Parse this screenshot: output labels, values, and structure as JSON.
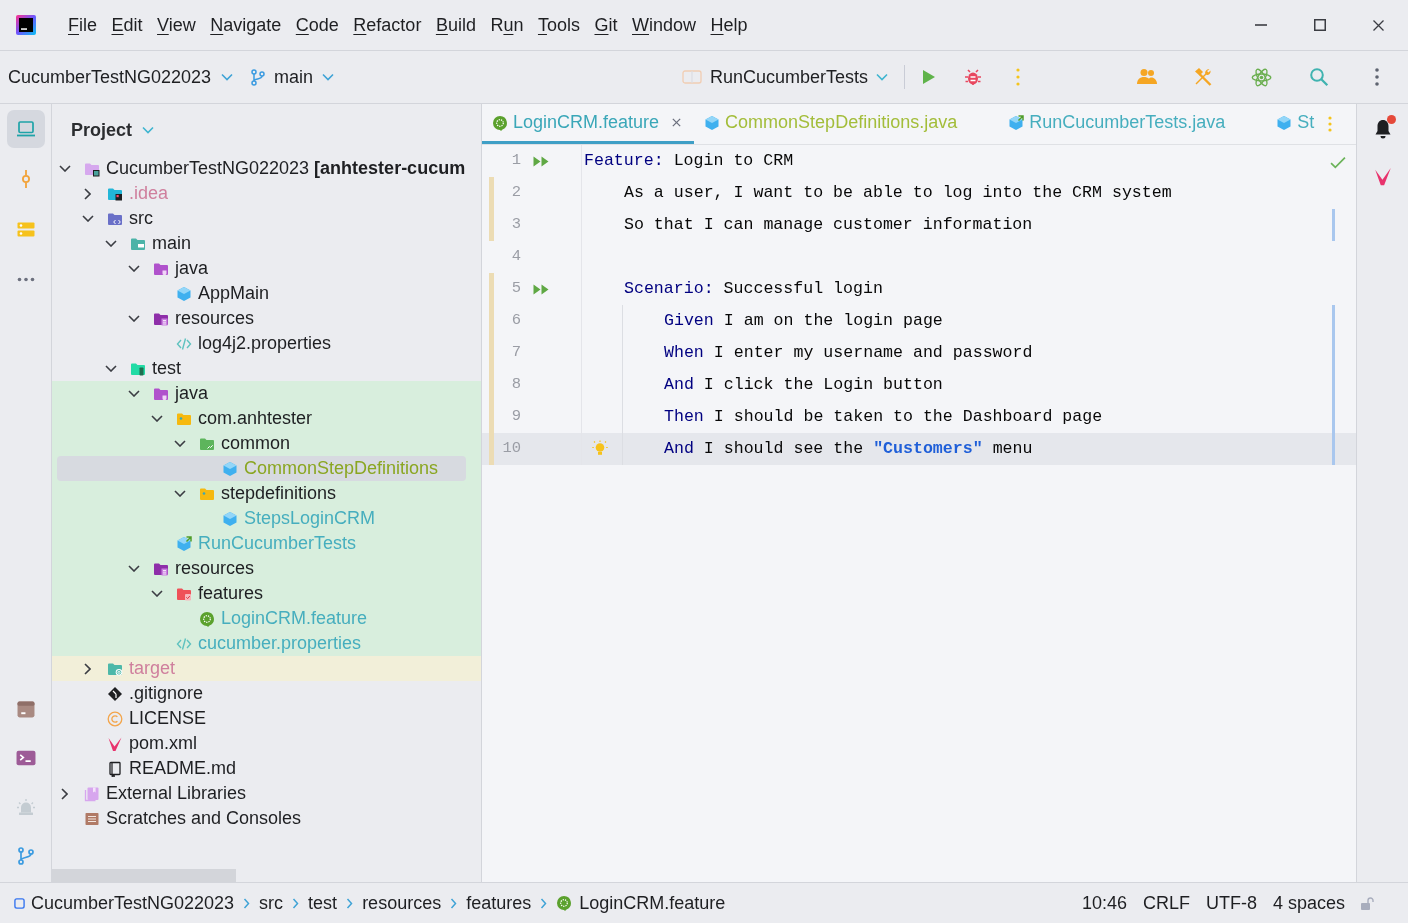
{
  "window": {
    "menu": [
      {
        "mnemonic": "F",
        "rest": "ile"
      },
      {
        "mnemonic": "E",
        "rest": "dit"
      },
      {
        "mnemonic": "V",
        "rest": "iew"
      },
      {
        "mnemonic": "N",
        "rest": "avigate"
      },
      {
        "mnemonic": "C",
        "rest": "ode"
      },
      {
        "mnemonic": "R",
        "rest": "efactor"
      },
      {
        "mnemonic": "B",
        "rest": "uild"
      },
      {
        "lead": "R",
        "mnemonic": "u",
        "rest": "n"
      },
      {
        "mnemonic": "T",
        "rest": "ools"
      },
      {
        "mnemonic": "G",
        "rest": "it"
      },
      {
        "mnemonic": "W",
        "rest": "indow"
      },
      {
        "mnemonic": "H",
        "rest": "elp"
      }
    ]
  },
  "toolbar": {
    "project": "CucumberTestNG022023",
    "branch": "main",
    "run_config": "RunCucumberTests"
  },
  "tool_strip": {
    "top": [
      {
        "kind": "project",
        "selected": true
      },
      {
        "kind": "commit",
        "selected": false
      },
      {
        "kind": "structure",
        "selected": false
      },
      {
        "kind": "more",
        "selected": false
      }
    ],
    "bottom": [
      {
        "kind": "services",
        "selected": false
      },
      {
        "kind": "terminal",
        "selected": false
      },
      {
        "kind": "problems",
        "selected": false
      },
      {
        "kind": "git",
        "selected": false
      }
    ]
  },
  "project_panel": {
    "title": "Project",
    "tree": [
      {
        "kind": "module",
        "label": "CucumberTestNG022023 **[anhtester-cucum**",
        "expanded": true,
        "selected": false,
        "children": [
          {
            "kind": "config",
            "label": ".idea",
            "color": "#cf7f9d",
            "expanded": false,
            "selected": false
          },
          {
            "kind": "src",
            "label": "src",
            "expanded": true,
            "selected": false,
            "children": [
              {
                "kind": "main",
                "label": "main",
                "expanded": true,
                "selected": false,
                "children": [
                  {
                    "kind": "javaroot",
                    "label": "java",
                    "expanded": true,
                    "selected": false,
                    "children": [
                      {
                        "kind": "class",
                        "label": "AppMain",
                        "selected": false
                      }
                    ]
                  },
                  {
                    "kind": "resroot",
                    "label": "resources",
                    "expanded": true,
                    "selected": false,
                    "children": [
                      {
                        "kind": "props",
                        "label": "log4j2.properties",
                        "selected": false
                      }
                    ]
                  }
                ]
              },
              {
                "kind": "testroot",
                "label": "test",
                "expanded": true,
                "selected": false,
                "children": [
                  {
                    "kind": "javaroot",
                    "label": "java",
                    "test_scope": true,
                    "expanded": true,
                    "selected": false,
                    "children": [
                      {
                        "kind": "package",
                        "label": "com.anhtester",
                        "test_scope": true,
                        "expanded": true,
                        "selected": false,
                        "children": [
                          {
                            "kind": "greenpackage",
                            "label": "common",
                            "test_scope": true,
                            "expanded": true,
                            "selected": false,
                            "children": [
                              {
                                "kind": "class",
                                "label": "CommonStepDefinitions",
                                "color": "#8aa621",
                                "test_scope": true,
                                "selected": true
                              }
                            ]
                          },
                          {
                            "kind": "package",
                            "label": "stepdefinitions",
                            "test_scope": true,
                            "expanded": true,
                            "selected": false,
                            "children": [
                              {
                                "kind": "class",
                                "label": "StepsLoginCRM",
                                "color": "#46aebe",
                                "test_scope": true,
                                "selected": false
                              }
                            ]
                          }
                        ]
                      },
                      {
                        "kind": "runner",
                        "label": "RunCucumberTests",
                        "color": "#46aebe",
                        "test_scope": true,
                        "selected": false
                      }
                    ]
                  },
                  {
                    "kind": "resroot",
                    "label": "resources",
                    "test_scope": true,
                    "expanded": true,
                    "selected": false,
                    "children": [
                      {
                        "kind": "featuredir",
                        "label": "features",
                        "test_scope": true,
                        "expanded": true,
                        "selected": false,
                        "children": [
                          {
                            "kind": "feature",
                            "label": "LoginCRM.feature",
                            "color": "#46aebe",
                            "test_scope": true,
                            "selected": false
                          }
                        ]
                      },
                      {
                        "kind": "props",
                        "label": "cucumber.properties",
                        "color": "#46aebe",
                        "test_scope": true,
                        "selected": false
                      }
                    ]
                  }
                ]
              }
            ]
          },
          {
            "kind": "excluded",
            "label": "target",
            "color": "#cf7f9d",
            "excluded": true,
            "expanded": false,
            "selected": false
          },
          {
            "kind": "git",
            "label": ".gitignore",
            "selected": false
          },
          {
            "kind": "license",
            "label": "LICENSE",
            "selected": false
          },
          {
            "kind": "maven",
            "label": "pom.xml",
            "selected": false
          },
          {
            "kind": "readme",
            "label": "README.md",
            "selected": false
          }
        ]
      },
      {
        "kind": "libraries",
        "label": "External Libraries",
        "expanded": false,
        "selected": false
      },
      {
        "kind": "scratches",
        "label": "Scratches and Consoles",
        "selected": false
      }
    ]
  },
  "editor": {
    "tabs": [
      {
        "kind": "feature",
        "label": "LoginCRM.feature",
        "color": "#3aa7b8",
        "selected": true
      },
      {
        "kind": "class",
        "label": "CommonStepDefinitions.java",
        "color": "#a3bd3a",
        "selected": false
      },
      {
        "kind": "runner",
        "label": "RunCucumberTests.java",
        "color": "#46aebe",
        "selected": false
      },
      {
        "kind": "class",
        "label": "St",
        "color": "#46aebe",
        "selected": false
      }
    ],
    "lines": [
      {
        "number": "1",
        "tokens": [
          {
            "kind": "keyword",
            "text": "Feature:"
          },
          {
            "kind": "text",
            "text": " Login to CRM"
          }
        ],
        "runnable": true,
        "changed": false,
        "marked": false,
        "current": false,
        "intention": false,
        "children": [
          {
            "number": "2",
            "tokens": [
              {
                "kind": "text",
                "text": "As a user, I want to be able to log into the CRM system"
              }
            ],
            "runnable": false,
            "changed": true,
            "marked": false,
            "current": false,
            "intention": false
          },
          {
            "number": "3",
            "tokens": [
              {
                "kind": "text",
                "text": "So that I can manage customer information"
              }
            ],
            "runnable": false,
            "changed": true,
            "marked": true,
            "current": false,
            "intention": false
          },
          {
            "number": "4",
            "runnable": false,
            "changed": false,
            "marked": false,
            "current": false,
            "intention": false
          },
          {
            "number": "5",
            "tokens": [
              {
                "kind": "keyword",
                "text": "Scenario:"
              },
              {
                "kind": "text",
                "text": " Successful login"
              }
            ],
            "runnable": true,
            "changed": true,
            "marked": false,
            "current": false,
            "intention": false,
            "children": [
              {
                "number": "6",
                "tokens": [
                  {
                    "kind": "keyword",
                    "text": "Given"
                  },
                  {
                    "kind": "text",
                    "text": " I am on the login page"
                  }
                ],
                "runnable": false,
                "changed": true,
                "marked": true,
                "current": false,
                "intention": false
              },
              {
                "number": "7",
                "tokens": [
                  {
                    "kind": "keyword",
                    "text": "When"
                  },
                  {
                    "kind": "text",
                    "text": " I enter my username and password"
                  }
                ],
                "runnable": false,
                "changed": true,
                "marked": true,
                "current": false,
                "intention": false
              },
              {
                "number": "8",
                "tokens": [
                  {
                    "kind": "keyword",
                    "text": "And"
                  },
                  {
                    "kind": "text",
                    "text": " I click the Login button"
                  }
                ],
                "runnable": false,
                "changed": true,
                "marked": true,
                "current": false,
                "intention": false
              },
              {
                "number": "9",
                "tokens": [
                  {
                    "kind": "keyword",
                    "text": "Then"
                  },
                  {
                    "kind": "text",
                    "text": " I should be taken to the Dashboard page"
                  }
                ],
                "runnable": false,
                "changed": true,
                "marked": true,
                "current": false,
                "intention": false
              },
              {
                "number": "10",
                "tokens": [
                  {
                    "kind": "keyword",
                    "text": "And"
                  },
                  {
                    "kind": "text",
                    "text": " I should see the "
                  },
                  {
                    "kind": "string",
                    "text": "\"Customers\""
                  },
                  {
                    "kind": "text",
                    "text": " menu"
                  }
                ],
                "runnable": false,
                "changed": true,
                "marked": true,
                "current": true,
                "intention": true
              }
            ]
          }
        ]
      }
    ]
  },
  "notifications": {
    "unread": true
  },
  "status_bar": {
    "breadcrumbs": [
      {
        "kind": "project",
        "label": "CucumberTestNG022023"
      },
      {
        "kind": "folder",
        "label": "src"
      },
      {
        "kind": "folder",
        "label": "test"
      },
      {
        "kind": "folder",
        "label": "resources"
      },
      {
        "kind": "folder",
        "label": "features"
      },
      {
        "kind": "feature",
        "label": "LoginCRM.feature"
      }
    ],
    "widgets": [
      "10:46",
      "CRLF",
      "UTF-8",
      "4 spaces"
    ]
  }
}
